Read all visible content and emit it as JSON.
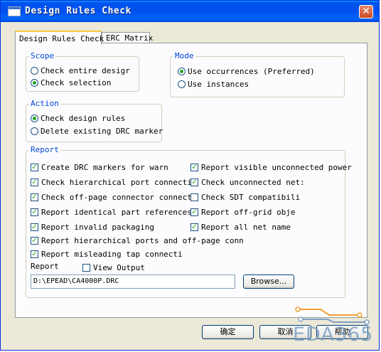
{
  "window": {
    "title": "Design Rules Check",
    "close": "✕"
  },
  "tabs": [
    {
      "label": "Design Rules Check"
    },
    {
      "label": "ERC Matrix"
    }
  ],
  "scope": {
    "legend": "Scope",
    "options": [
      {
        "label": "Check entire desigr",
        "selected": false
      },
      {
        "label": "Check selection",
        "selected": true
      }
    ]
  },
  "mode": {
    "legend": "Mode",
    "options": [
      {
        "label": "Use occurrences (Preferred)",
        "selected": true
      },
      {
        "label": "Use instances",
        "selected": false
      }
    ]
  },
  "action": {
    "legend": "Action",
    "options": [
      {
        "label": "Check design rules",
        "selected": true
      },
      {
        "label": "Delete existing DRC marker",
        "selected": false
      }
    ]
  },
  "report": {
    "legend": "Report",
    "left": [
      {
        "label": "Create DRC markers for warn",
        "checked": true
      },
      {
        "label": "Check hierarchical port connectio",
        "checked": true
      },
      {
        "label": "Check off-page connector connecti",
        "checked": true
      },
      {
        "label": "Report identical part references",
        "checked": true
      },
      {
        "label": "Report invalid packaging",
        "checked": true
      },
      {
        "label": "Report hierarchical ports and off-page conn",
        "checked": true
      },
      {
        "label": "Report misleading tap connecti",
        "checked": true
      }
    ],
    "right": [
      {
        "label": "Report visible unconnected power",
        "checked": true
      },
      {
        "label": "Check unconnected net:",
        "checked": true
      },
      {
        "label": "Check SDT compatibili",
        "checked": false
      },
      {
        "label": "Report off-grid obje",
        "checked": true
      },
      {
        "label": "Report all net name",
        "checked": true
      }
    ],
    "file_label": "Report",
    "view_output": {
      "label": "View Output",
      "checked": false
    },
    "path": "D:\\EPEAD\\CA4000P.DRC",
    "browse": "Browse..."
  },
  "buttons": {
    "ok": "确定",
    "cancel": "取消",
    "help": "帮助"
  },
  "watermark": "EDA365",
  "colors": {
    "title_bar": "#0053ee",
    "legend": "#0046d5",
    "check": "#21a121"
  }
}
